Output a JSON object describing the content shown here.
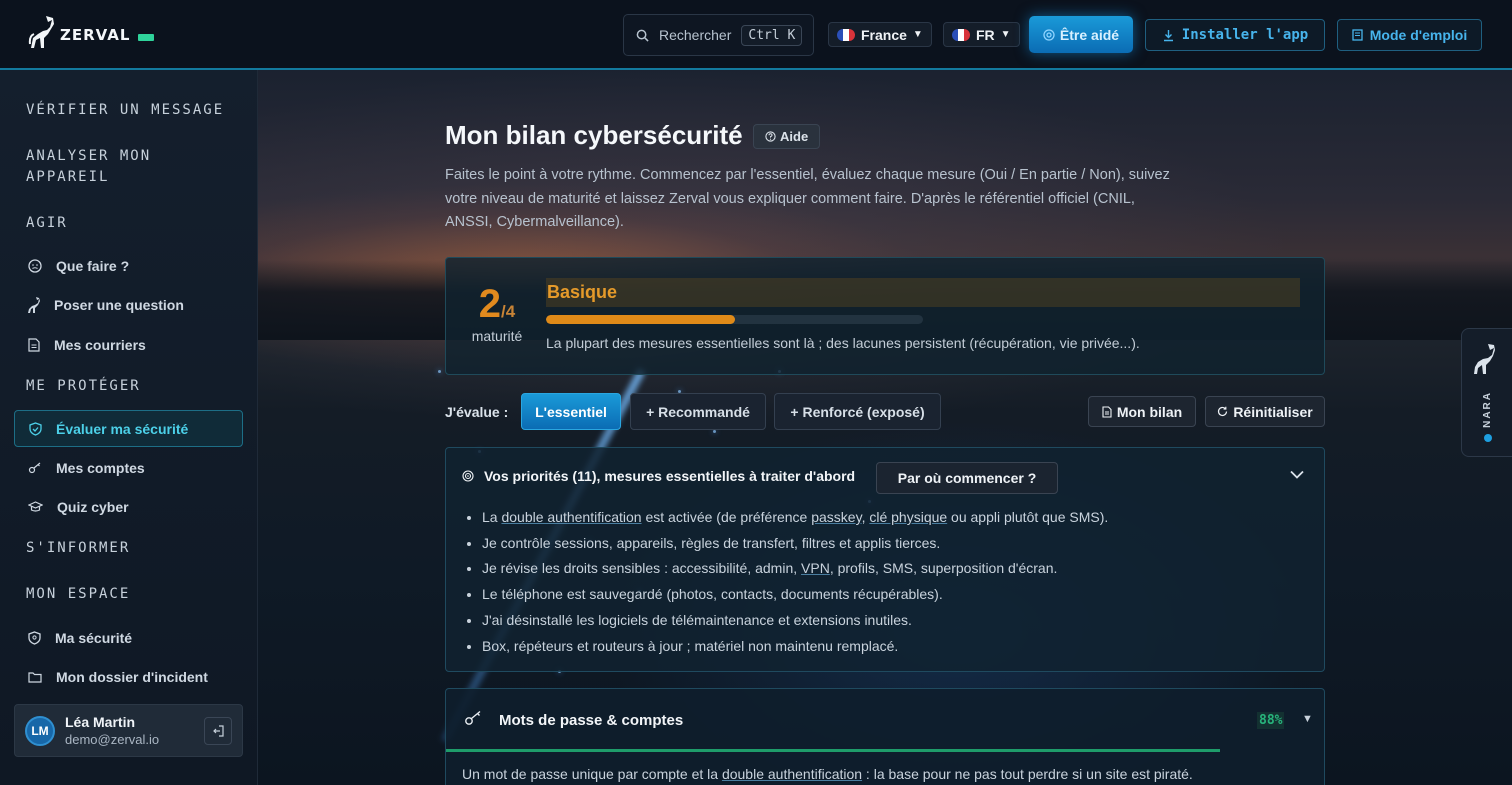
{
  "header": {
    "logo_text": "ZERVAL",
    "search": {
      "placeholder": "Rechercher",
      "shortcut": "Ctrl K"
    },
    "country": "France",
    "language": "FR",
    "help_button": "Être aidé",
    "install_button": "Installer l'app",
    "manual_button": "Mode d'emploi"
  },
  "sidebar": {
    "sections": {
      "verify": "VÉRIFIER UN MESSAGE",
      "analyze_line1": "ANALYSER MON",
      "analyze_line2": "APPAREIL",
      "act": "AGIR",
      "protect": "ME PROTÉGER",
      "inform": "S'INFORMER",
      "space": "MON ESPACE"
    },
    "items": {
      "what_to_do": "Que faire ?",
      "ask_question": "Poser une question",
      "my_letters": "Mes courriers",
      "evaluate": "Évaluer ma sécurité",
      "my_accounts": "Mes comptes",
      "quiz": "Quiz cyber",
      "my_security": "Ma sécurité",
      "incident_folder": "Mon dossier d'incident"
    },
    "user": {
      "initials": "LM",
      "name": "Léa Martin",
      "email": "demo@zerval.io"
    }
  },
  "main": {
    "title": "Mon bilan cybersécurité",
    "help_badge": "Aide",
    "intro": "Faites le point à votre rythme. Commencez par l'essentiel, évaluez chaque mesure (Oui / En partie / Non), suivez votre niveau de maturité et laissez Zerval vous expliquer comment faire. D'après le référentiel officiel (CNIL, ANSSI, Cybermalveillance).",
    "maturity": {
      "level": "2",
      "max": "/4",
      "caption": "maturité",
      "name": "Basique",
      "progress_fraction": 0.5,
      "description": "La plupart des mesures essentielles sont là ; des lacunes persistent (récupération, vie privée...)."
    },
    "evaluate_label": "J'évalue :",
    "tabs": [
      "L'essentiel",
      "+ Recommandé",
      "+ Renforcé (exposé)"
    ],
    "actions": {
      "report": "Mon bilan",
      "reset": "Réinitialiser"
    },
    "priorities": {
      "title": "Vos priorités (11), mesures essentielles à traiter d'abord",
      "start_button": "Par où commencer ?",
      "items": {
        "i1_a": "La ",
        "i1_link1": "double authentification",
        "i1_b": " est activée (de préférence ",
        "i1_link2": "passkey",
        "i1_c": ", ",
        "i1_link3": "clé physique",
        "i1_d": " ou appli plutôt que SMS).",
        "i2": "Je contrôle sessions, appareils, règles de transfert, filtres et applis tierces.",
        "i3_a": "Je révise les droits sensibles : accessibilité, admin, ",
        "i3_link": "VPN",
        "i3_b": ", profils, SMS, superposition d'écran.",
        "i4": "Le téléphone est sauvegardé (photos, contacts, documents récupérables).",
        "i5": "J'ai désinstallé les logiciels de télémaintenance et extensions inutiles.",
        "i6": "Box, répéteurs et routeurs à jour ; matériel non maintenu remplacé."
      }
    },
    "category": {
      "title": "Mots de passe & comptes",
      "percent": "88%",
      "progress_fraction": 0.88,
      "desc_a": "Un mot de passe unique par compte et la ",
      "desc_link": "double authentification",
      "desc_b": " : la base pour ne pas tout perdre si un site est piraté."
    }
  },
  "nara": {
    "label": "NARA"
  },
  "colors": {
    "accent": "#1a9ad8",
    "warning": "#df8a18",
    "success": "#27b37b"
  }
}
